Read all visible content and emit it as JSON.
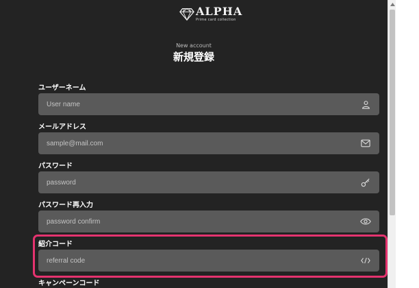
{
  "brand": {
    "name": "ALPHA",
    "tagline": "Prime card collection"
  },
  "heading": {
    "eyebrow": "New account",
    "title": "新規登録"
  },
  "form": {
    "username": {
      "label": "ユーザーネーム",
      "placeholder": "User name",
      "icon": "user-icon"
    },
    "email": {
      "label": "メールアドレス",
      "placeholder": "sample@mail.com",
      "icon": "mail-icon"
    },
    "password": {
      "label": "パスワード",
      "placeholder": "password",
      "icon": "key-icon"
    },
    "password_confirm": {
      "label": "パスワード再入力",
      "placeholder": "password confirm",
      "icon": "eye-icon"
    },
    "referral": {
      "label": "紹介コード",
      "placeholder": "referral code",
      "icon": "code-icon"
    },
    "campaign": {
      "label": "キャンペーンコード"
    }
  },
  "colors": {
    "background": "#232323",
    "field": "#5a5a5a",
    "highlight": "#e5336f"
  }
}
